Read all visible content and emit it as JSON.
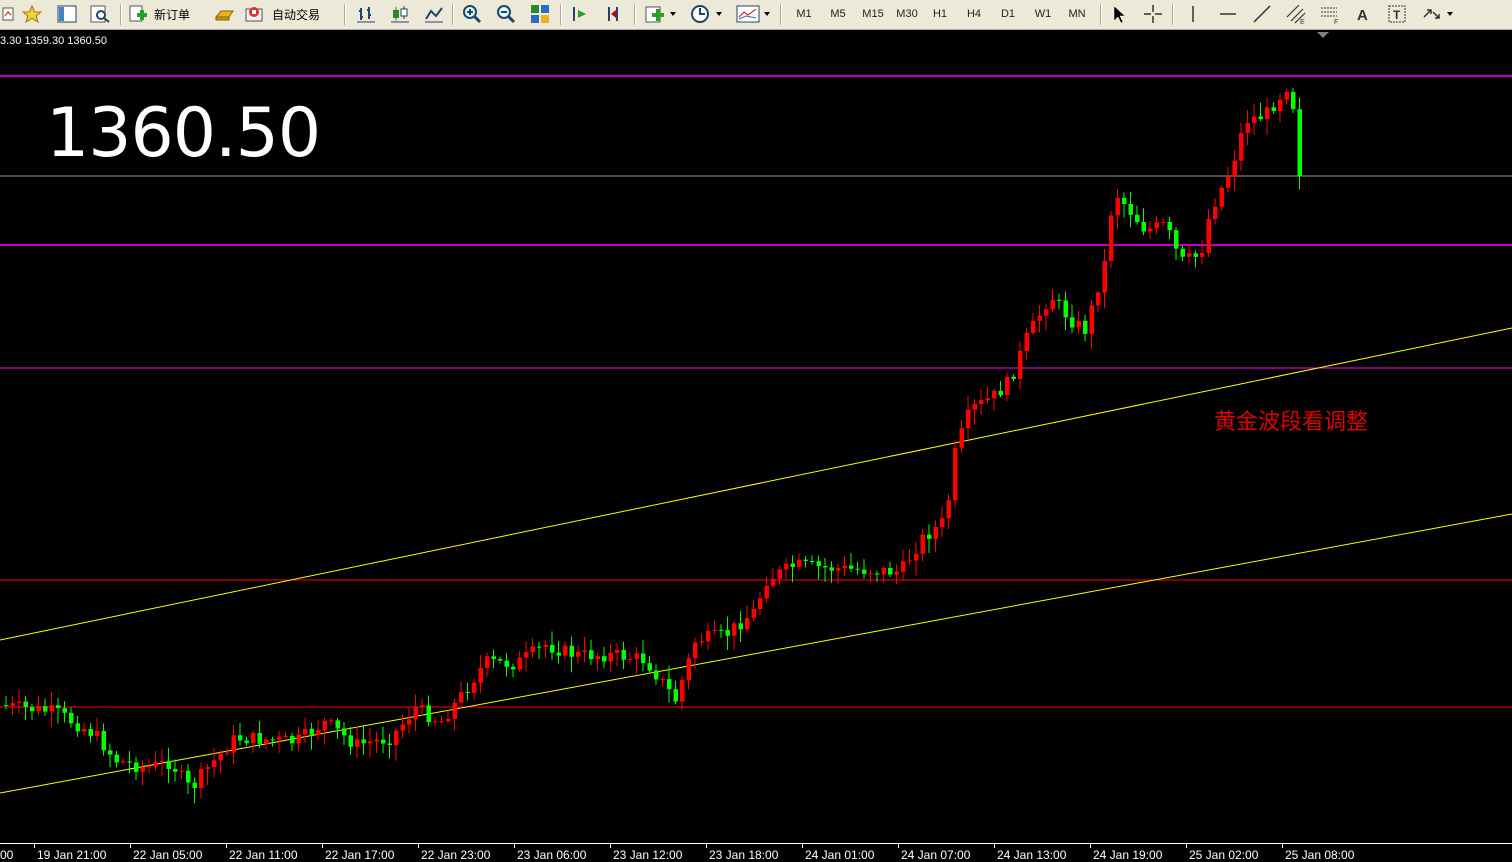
{
  "toolbar": {
    "new_order_label": "新订单",
    "auto_trade_label": "自动交易",
    "timeframes": [
      "M1",
      "M5",
      "M15",
      "M30",
      "H1",
      "H4",
      "D1",
      "W1",
      "MN"
    ],
    "icons": [
      "new-chart-icon",
      "favorites-icon",
      "profiles-icon",
      "navigator-icon",
      "new-order-icon",
      "gold-bar-icon",
      "auto-trading-icon",
      "bar-chart-icon",
      "candlestick-icon",
      "line-chart-icon",
      "zoom-in-icon",
      "zoom-out-icon",
      "tile-windows-icon",
      "chart-shift-icon",
      "autoscroll-icon",
      "indicators-icon",
      "periods-icon",
      "templates-icon",
      "cursor-icon",
      "crosshair-icon",
      "vertical-line-icon",
      "horizontal-line-icon",
      "trendline-icon",
      "equidistant-channel-icon",
      "fibonacci-icon",
      "text-icon",
      "text-label-icon",
      "arrows-icon"
    ]
  },
  "chart": {
    "ohlc_text": "3.30 1359.30 1360.50",
    "big_price": "1360.50",
    "note": "黄金波段看调整",
    "colors": {
      "bull": "#ff0000",
      "bear": "#00ff00",
      "magenta_line": "#ff00ff",
      "red_line": "#ff0000",
      "channel": "#ffff00",
      "price_line": "#a0a0a0"
    },
    "x_labels": [
      "00",
      "19 Jan 21:00",
      "22 Jan 05:00",
      "22 Jan 11:00",
      "22 Jan 17:00",
      "22 Jan 23:00",
      "23 Jan 06:00",
      "23 Jan 12:00",
      "23 Jan 18:00",
      "24 Jan 01:00",
      "24 Jan 07:00",
      "24 Jan 13:00",
      "24 Jan 19:00",
      "25 Jan 02:00",
      "25 Jan 08:00"
    ]
  }
}
